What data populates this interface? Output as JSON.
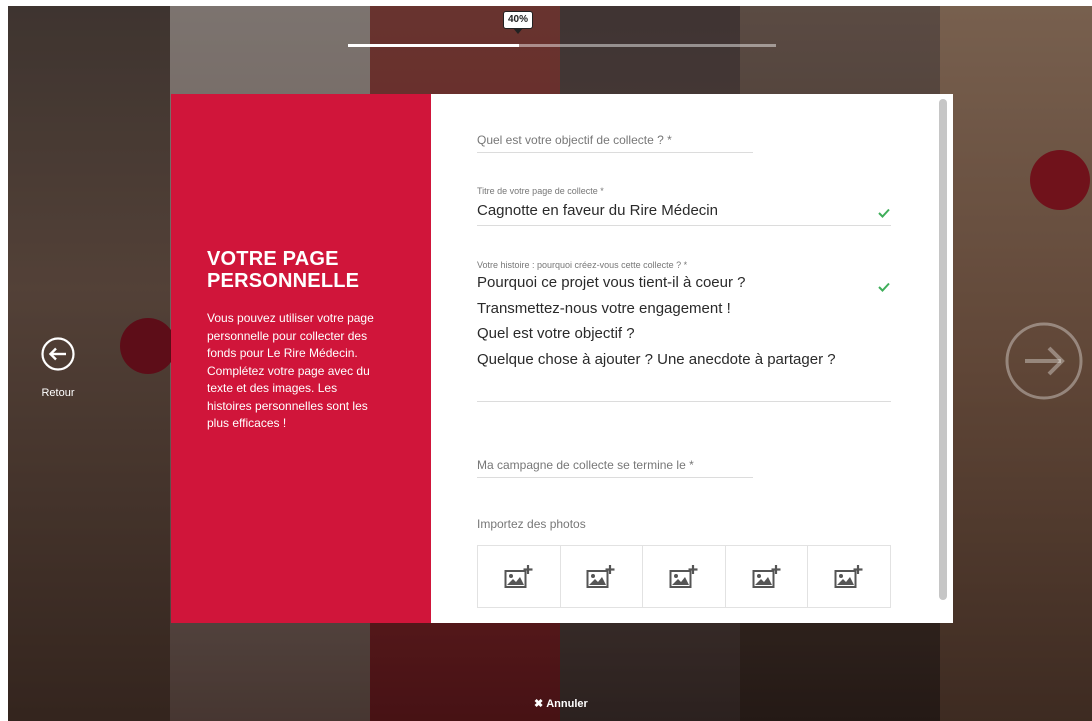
{
  "progress": {
    "label": "40%",
    "value": 0.4
  },
  "nav": {
    "back_label": "Retour",
    "cancel_label": "Annuler"
  },
  "intro": {
    "title": "VOTRE PAGE PERSONNELLE",
    "text": "Vous pouvez utiliser votre page personnelle pour collecter des fonds pour Le Rire Médecin. Complétez votre page avec du texte et des images. Les histoires personnelles sont les plus efficaces !"
  },
  "form": {
    "goal": {
      "placeholder": "Quel est votre objectif de collecte ? *"
    },
    "title": {
      "label": "Titre de votre page de collecte *",
      "value": "Cagnotte en faveur du Rire Médecin"
    },
    "story": {
      "label": "Votre histoire : pourquoi créez-vous cette collecte ? *",
      "value": "Pourquoi ce projet vous tient-il à coeur ?\nTransmettez-nous votre engagement !\nQuel est votre objectif ?\nQuelque chose à ajouter ? Une anecdote à partager ?"
    },
    "end_date": {
      "placeholder": "Ma campagne de collecte se termine le *"
    },
    "photos": {
      "label": "Importez des photos",
      "slots": 5
    }
  },
  "colors": {
    "brand_red": "#d0153a",
    "check_green": "#3fae5a"
  },
  "icons": {
    "back": "circle-arrow-left-icon",
    "next": "circle-arrow-right-icon",
    "check": "check-icon",
    "photo": "add-photo-icon",
    "cancel": "close-icon"
  }
}
